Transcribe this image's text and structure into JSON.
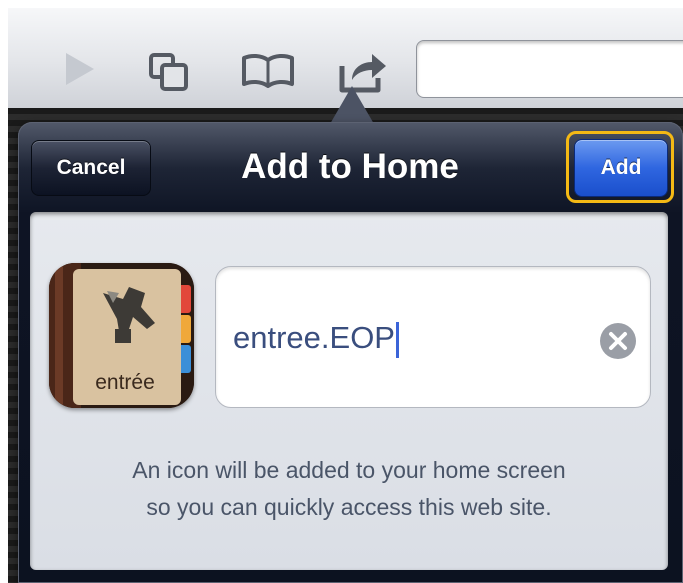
{
  "toolbar": {
    "icons": [
      "play-back-icon",
      "tabs-icon",
      "bookmarks-icon",
      "share-icon"
    ],
    "url_value": ""
  },
  "dialog": {
    "title": "Add to Home",
    "cancel_label": "Cancel",
    "add_label": "Add",
    "name_value": "entree.EOP",
    "app_icon_label": "entrée",
    "info_line1": "An icon will be added to your home screen",
    "info_line2": "so you can quickly access this web site."
  },
  "colors": {
    "add_button": "#2f66e0",
    "highlight": "#f4b915",
    "header": "#0e1424"
  }
}
